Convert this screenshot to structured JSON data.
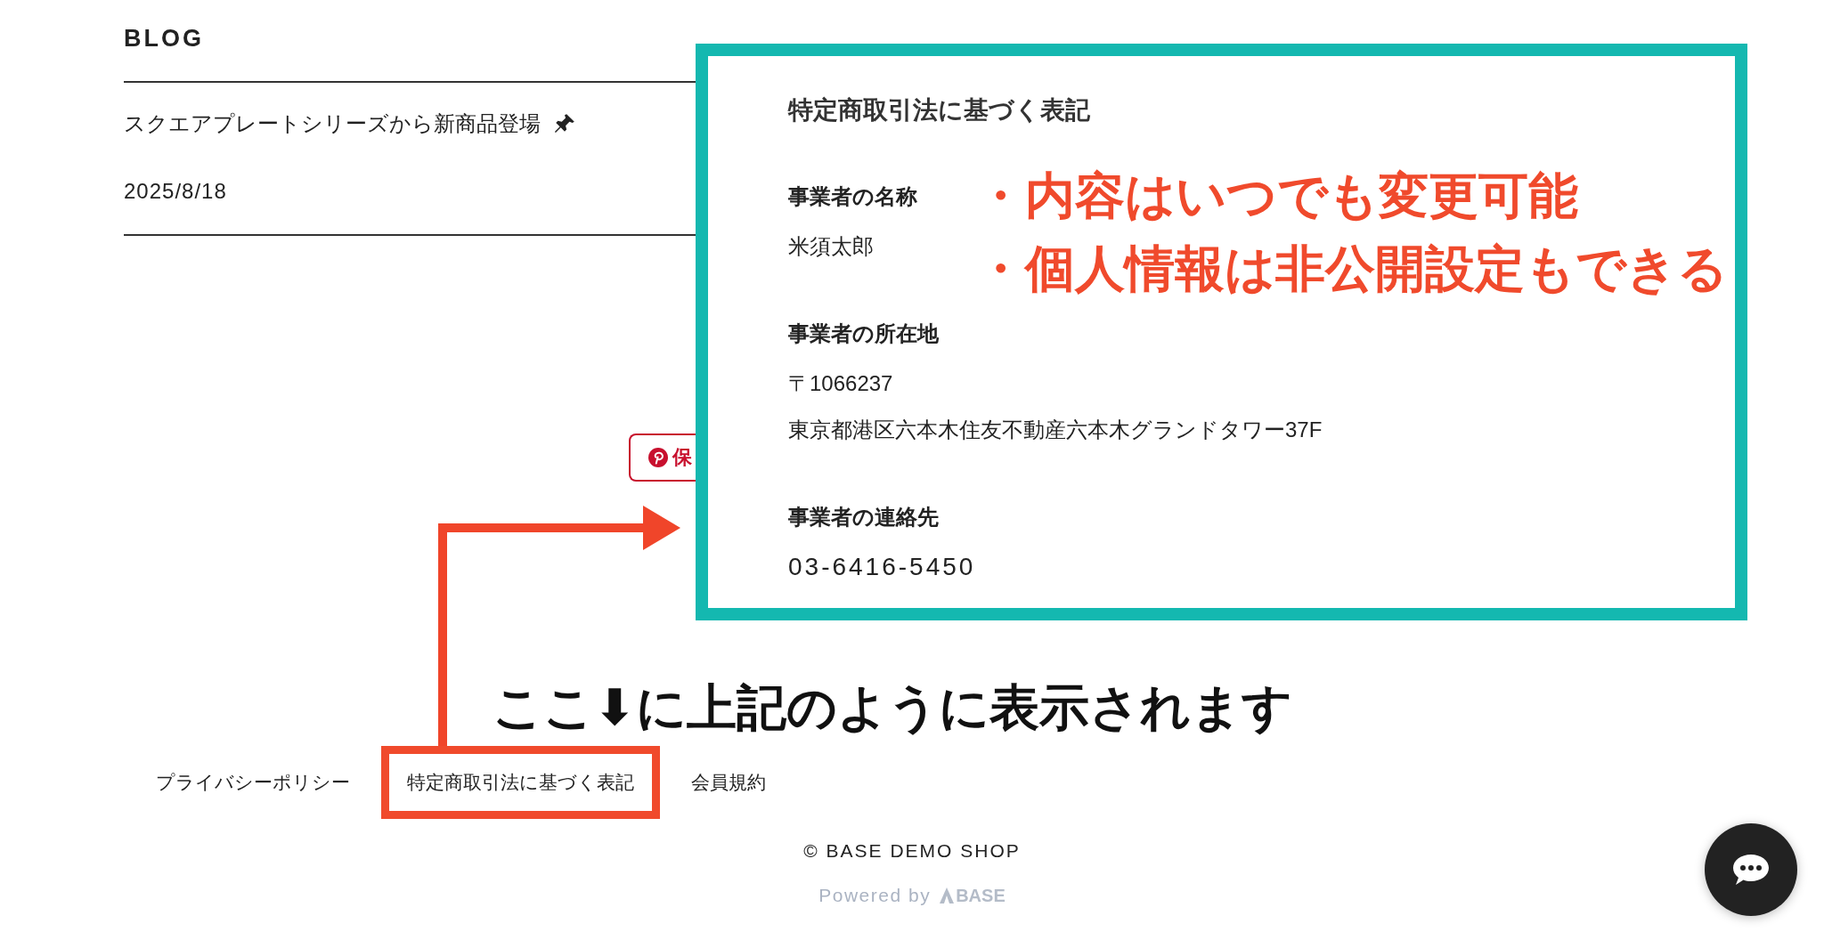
{
  "blog": {
    "heading": "BLOG",
    "posts": [
      {
        "title": "スクエアプレートシリーズから新商品登場",
        "pinned": true,
        "date": "2025/8/18"
      }
    ]
  },
  "pin_button": {
    "label": "保"
  },
  "legal_panel": {
    "title": "特定商取引法に基づく表記",
    "sections": [
      {
        "label": "事業者の名称",
        "lines": [
          "米須太郎"
        ]
      },
      {
        "label": "事業者の所在地",
        "lines": [
          "〒1066237",
          "東京都港区六本木住友不動産六本木グランドタワー37F"
        ]
      },
      {
        "label": "事業者の連絡先",
        "lines": [
          "03-6416-5450"
        ],
        "kind": "phone"
      }
    ]
  },
  "annotations": {
    "notes": [
      "・内容はいつでも変更可能",
      "・個人情報は非公開設定もできる"
    ],
    "caption": "ここ⬇に上記のように表示されます"
  },
  "footer": {
    "links": [
      {
        "label": "プライバシーポリシー",
        "highlighted": false
      },
      {
        "label": "特定商取引法に基づく表記",
        "highlighted": true
      },
      {
        "label": "会員規約",
        "highlighted": false
      }
    ],
    "copyright": "© BASE DEMO SHOP",
    "powered_by": "Powered by",
    "brand": "BASE"
  }
}
